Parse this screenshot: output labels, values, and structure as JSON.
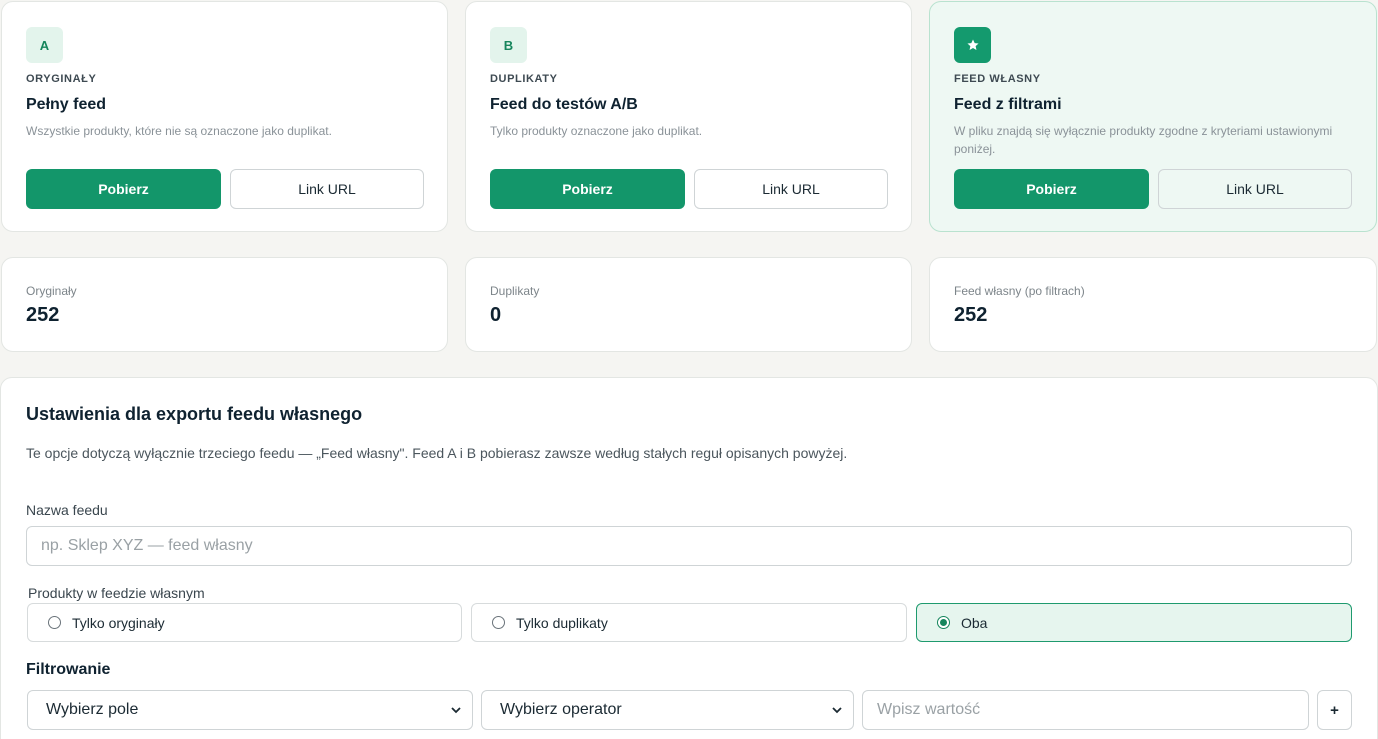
{
  "feeds": [
    {
      "badge": "A",
      "kicker": "ORYGINAŁY",
      "title": "Pełny feed",
      "description": "Wszystkie produkty, które nie są oznaczone jako duplikat.",
      "download_label": "Pobierz",
      "link_label": "Link URL"
    },
    {
      "badge": "B",
      "kicker": "DUPLIKATY",
      "title": "Feed do testów A/B",
      "description": "Tylko produkty oznaczone jako duplikat.",
      "download_label": "Pobierz",
      "link_label": "Link URL"
    },
    {
      "badge_icon": "star-icon",
      "kicker": "FEED WŁASNY",
      "title": "Feed z filtrami",
      "description": "W pliku znajdą się wyłącznie produkty zgodne z kryteriami ustawionymi poniżej.",
      "download_label": "Pobierz",
      "link_label": "Link URL"
    }
  ],
  "stats": [
    {
      "label": "Oryginały",
      "value": "252"
    },
    {
      "label": "Duplikaty",
      "value": "0"
    },
    {
      "label": "Feed własny (po filtrach)",
      "value": "252"
    }
  ],
  "settings": {
    "title": "Ustawienia dla exportu feedu własnego",
    "description": "Te opcje dotyczą wyłącznie trzeciego feedu — „Feed własny\". Feed A i B pobierasz zawsze według stałych reguł opisanych powyżej.",
    "name_label": "Nazwa feedu",
    "name_value": "",
    "name_placeholder": "np. Sklep XYZ — feed własny",
    "products_label": "Produkty w feedzie własnym",
    "product_options": [
      {
        "label": "Tylko oryginały",
        "selected": false
      },
      {
        "label": "Tylko duplikaty",
        "selected": false
      },
      {
        "label": "Oba",
        "selected": true
      }
    ],
    "filter_title": "Filtrowanie",
    "field_select": "Wybierz pole",
    "operator_select": "Wybierz operator",
    "value_placeholder": "Wpisz wartość",
    "add_label": "+"
  },
  "colors": {
    "accent": "#13966a",
    "badge_bg": "#e3f4ec",
    "highlight_bg": "#eef8f3",
    "selected_bg": "#e6f5ee"
  }
}
